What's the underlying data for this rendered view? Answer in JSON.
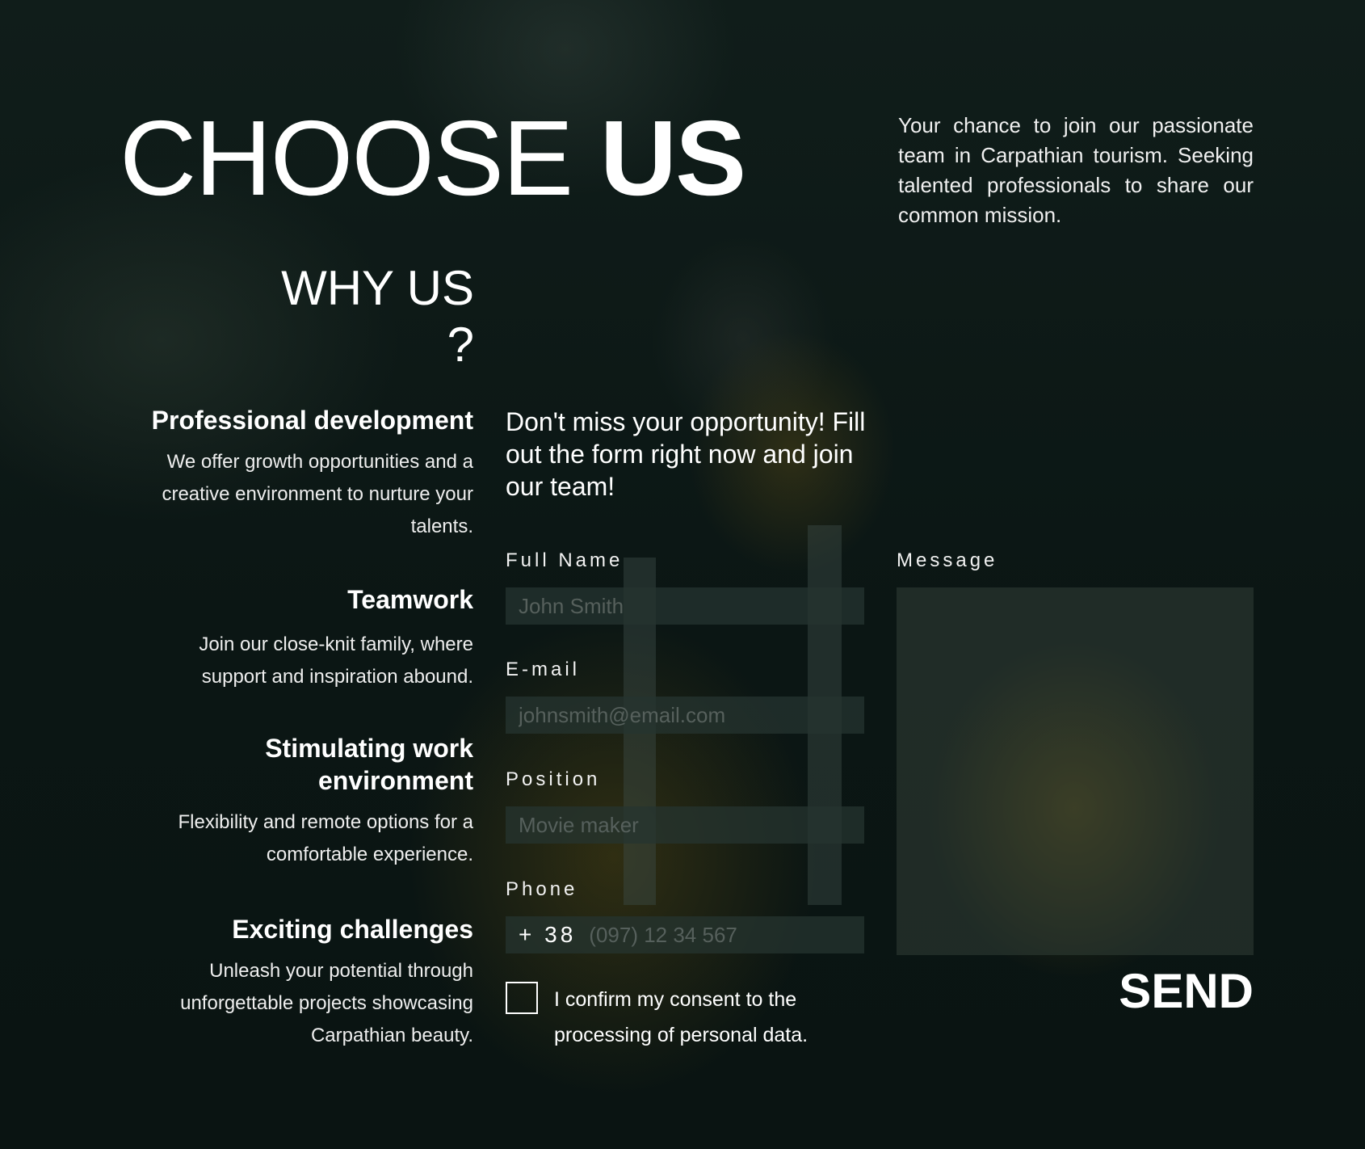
{
  "header": {
    "title_light": "CHOOSE",
    "title_bold": "US",
    "intro": "Your chance to join our passionate team in Carpathian tourism. Seeking talented professionals to share our common mission."
  },
  "why": {
    "heading": "WHY US ?",
    "features": [
      {
        "title": "Professional development",
        "text": "We offer growth opportunities and a creative environment to nurture your talents."
      },
      {
        "title": "Teamwork",
        "text": "Join our close-knit family, where support and inspiration abound."
      },
      {
        "title": "Stimulating work environment",
        "text": "Flexibility and remote options for a comfortable experience."
      },
      {
        "title": "Exciting challenges",
        "text": "Unleash your potential through unforgettable projects showcasing Carpathian beauty."
      }
    ]
  },
  "form": {
    "cta": "Don't miss your opportunity! Fill out the form right now and join our team!",
    "full_name": {
      "label": "Full Name",
      "placeholder": "John Smith"
    },
    "email": {
      "label": "E-mail",
      "placeholder": "johnsmith@email.com"
    },
    "position": {
      "label": "Position",
      "placeholder": "Movie maker"
    },
    "phone": {
      "label": "Phone",
      "prefix": "+ 38",
      "placeholder": "(097) 12 34 567"
    },
    "message": {
      "label": "Message",
      "value": ""
    },
    "consent": {
      "text": "I confirm my consent to the processing of personal data.",
      "checked": false
    },
    "send_label": "SEND"
  }
}
